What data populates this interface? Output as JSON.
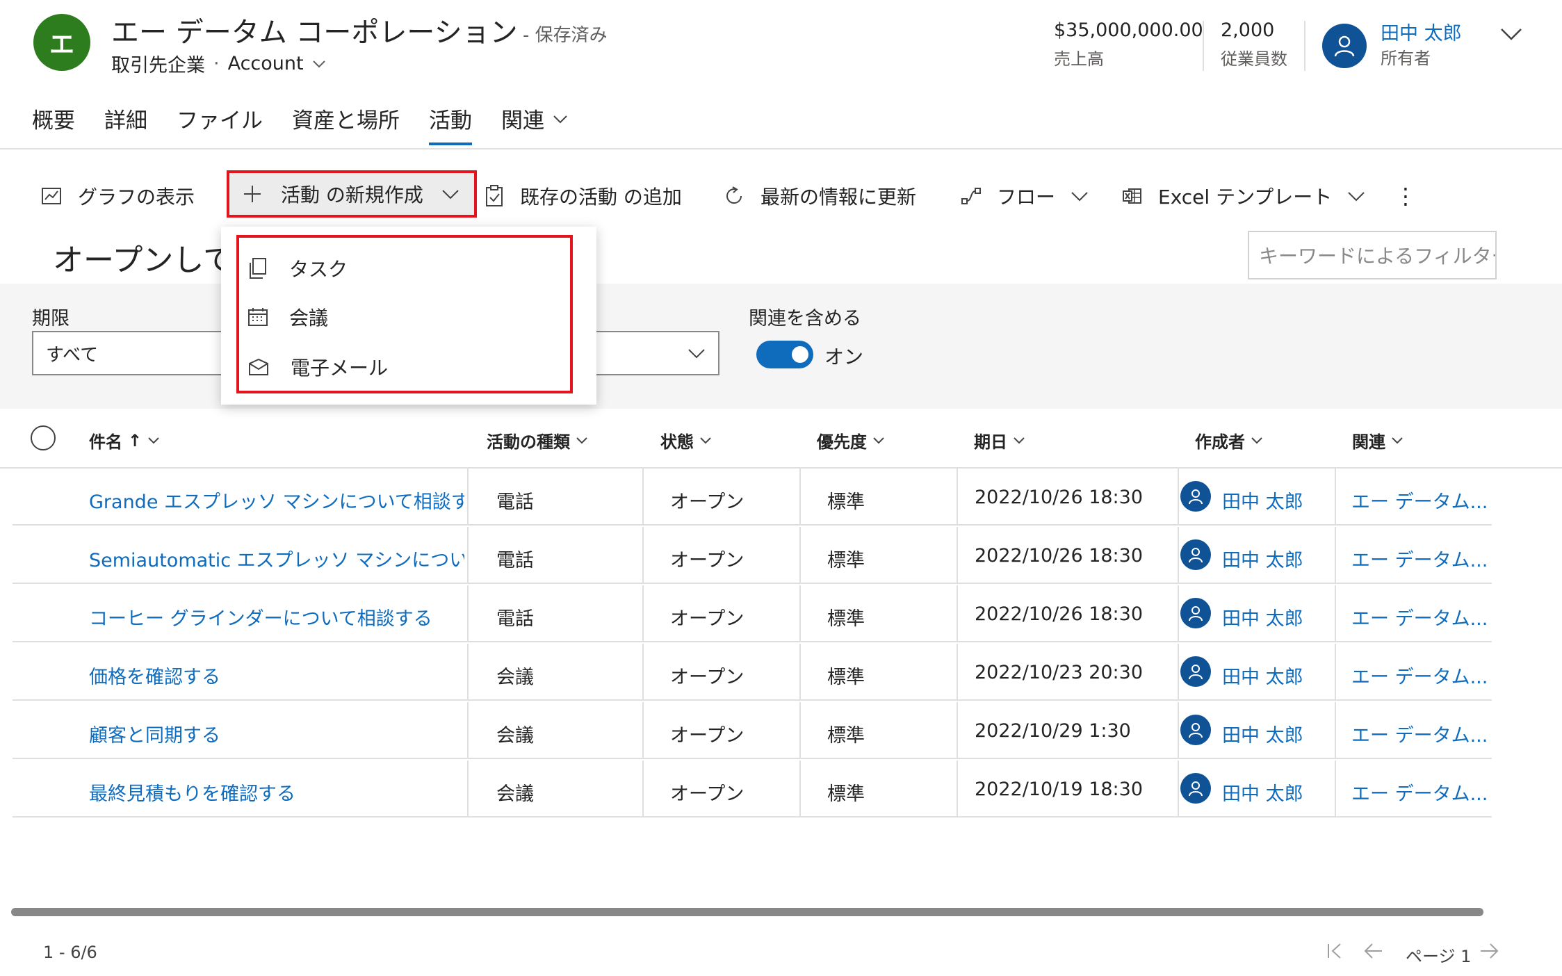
{
  "record": {
    "avatar_initial": "エ",
    "title": "エー データム コーポレーション",
    "saved_status": "- 保存済み",
    "entity_type": "取引先企業",
    "separator": "·",
    "form_name": "Account",
    "avatar_color": "#2d7d1e"
  },
  "kpis": [
    {
      "value": "$35,000,000.00",
      "label": "売上高"
    },
    {
      "value": "2,000",
      "label": "従業員数"
    }
  ],
  "owner": {
    "name": "田中 太郎",
    "role": "所有者"
  },
  "tabs": [
    {
      "label": "概要"
    },
    {
      "label": "詳細"
    },
    {
      "label": "ファイル"
    },
    {
      "label": "資産と場所"
    },
    {
      "label": "活動",
      "active": true
    },
    {
      "label": "関連"
    }
  ],
  "commands": {
    "show_chart": "グラフの表示",
    "new_activity": "活動 の新規作成",
    "add_existing": "既存の活動 の追加",
    "refresh": "最新の情報に更新",
    "flow": "フロー",
    "excel_templates": "Excel テンプレート",
    "more": "⋮"
  },
  "new_activity_menu": [
    {
      "label": "タスク",
      "icon": "task-icon"
    },
    {
      "label": "会議",
      "icon": "calendar-icon"
    },
    {
      "label": "電子メール",
      "icon": "email-icon"
    }
  ],
  "view_title": "オープンして",
  "filter_placeholder": "キーワードによるフィルター",
  "filters": {
    "due_label": "期限",
    "due_value": "すべて",
    "include_related_label": "関連を含める",
    "include_related_value": "オン",
    "include_related_on": true
  },
  "grid": {
    "columns": [
      "件名",
      "活動の種類",
      "状態",
      "優先度",
      "期日",
      "作成者",
      "関連"
    ],
    "sort_indicator": "↑",
    "rows": [
      {
        "subject": "Grande エスプレッソ マシンについて相談する",
        "type": "電話",
        "status": "オープン",
        "priority": "標準",
        "due": "2022/10/26 18:30",
        "owner": "田中 太郎",
        "regarding": "エー データム..."
      },
      {
        "subject": "Semiautomatic エスプレッソ マシンについて...",
        "type": "電話",
        "status": "オープン",
        "priority": "標準",
        "due": "2022/10/26 18:30",
        "owner": "田中 太郎",
        "regarding": "エー データム..."
      },
      {
        "subject": "コーヒー グラインダーについて相談する",
        "type": "電話",
        "status": "オープン",
        "priority": "標準",
        "due": "2022/10/26 18:30",
        "owner": "田中 太郎",
        "regarding": "エー データム..."
      },
      {
        "subject": "価格を確認する",
        "type": "会議",
        "status": "オープン",
        "priority": "標準",
        "due": "2022/10/23 20:30",
        "owner": "田中 太郎",
        "regarding": "エー データム..."
      },
      {
        "subject": "顧客と同期する",
        "type": "会議",
        "status": "オープン",
        "priority": "標準",
        "due": "2022/10/29 1:30",
        "owner": "田中 太郎",
        "regarding": "エー データム..."
      },
      {
        "subject": "最終見積もりを確認する",
        "type": "会議",
        "status": "オープン",
        "priority": "標準",
        "due": "2022/10/19 18:30",
        "owner": "田中 太郎",
        "regarding": "エー データム..."
      }
    ]
  },
  "footer": {
    "count": "1 - 6/6",
    "page": "ページ 1"
  },
  "colors": {
    "accent": "#0f6cbd",
    "highlight_border": "#e3141e"
  }
}
